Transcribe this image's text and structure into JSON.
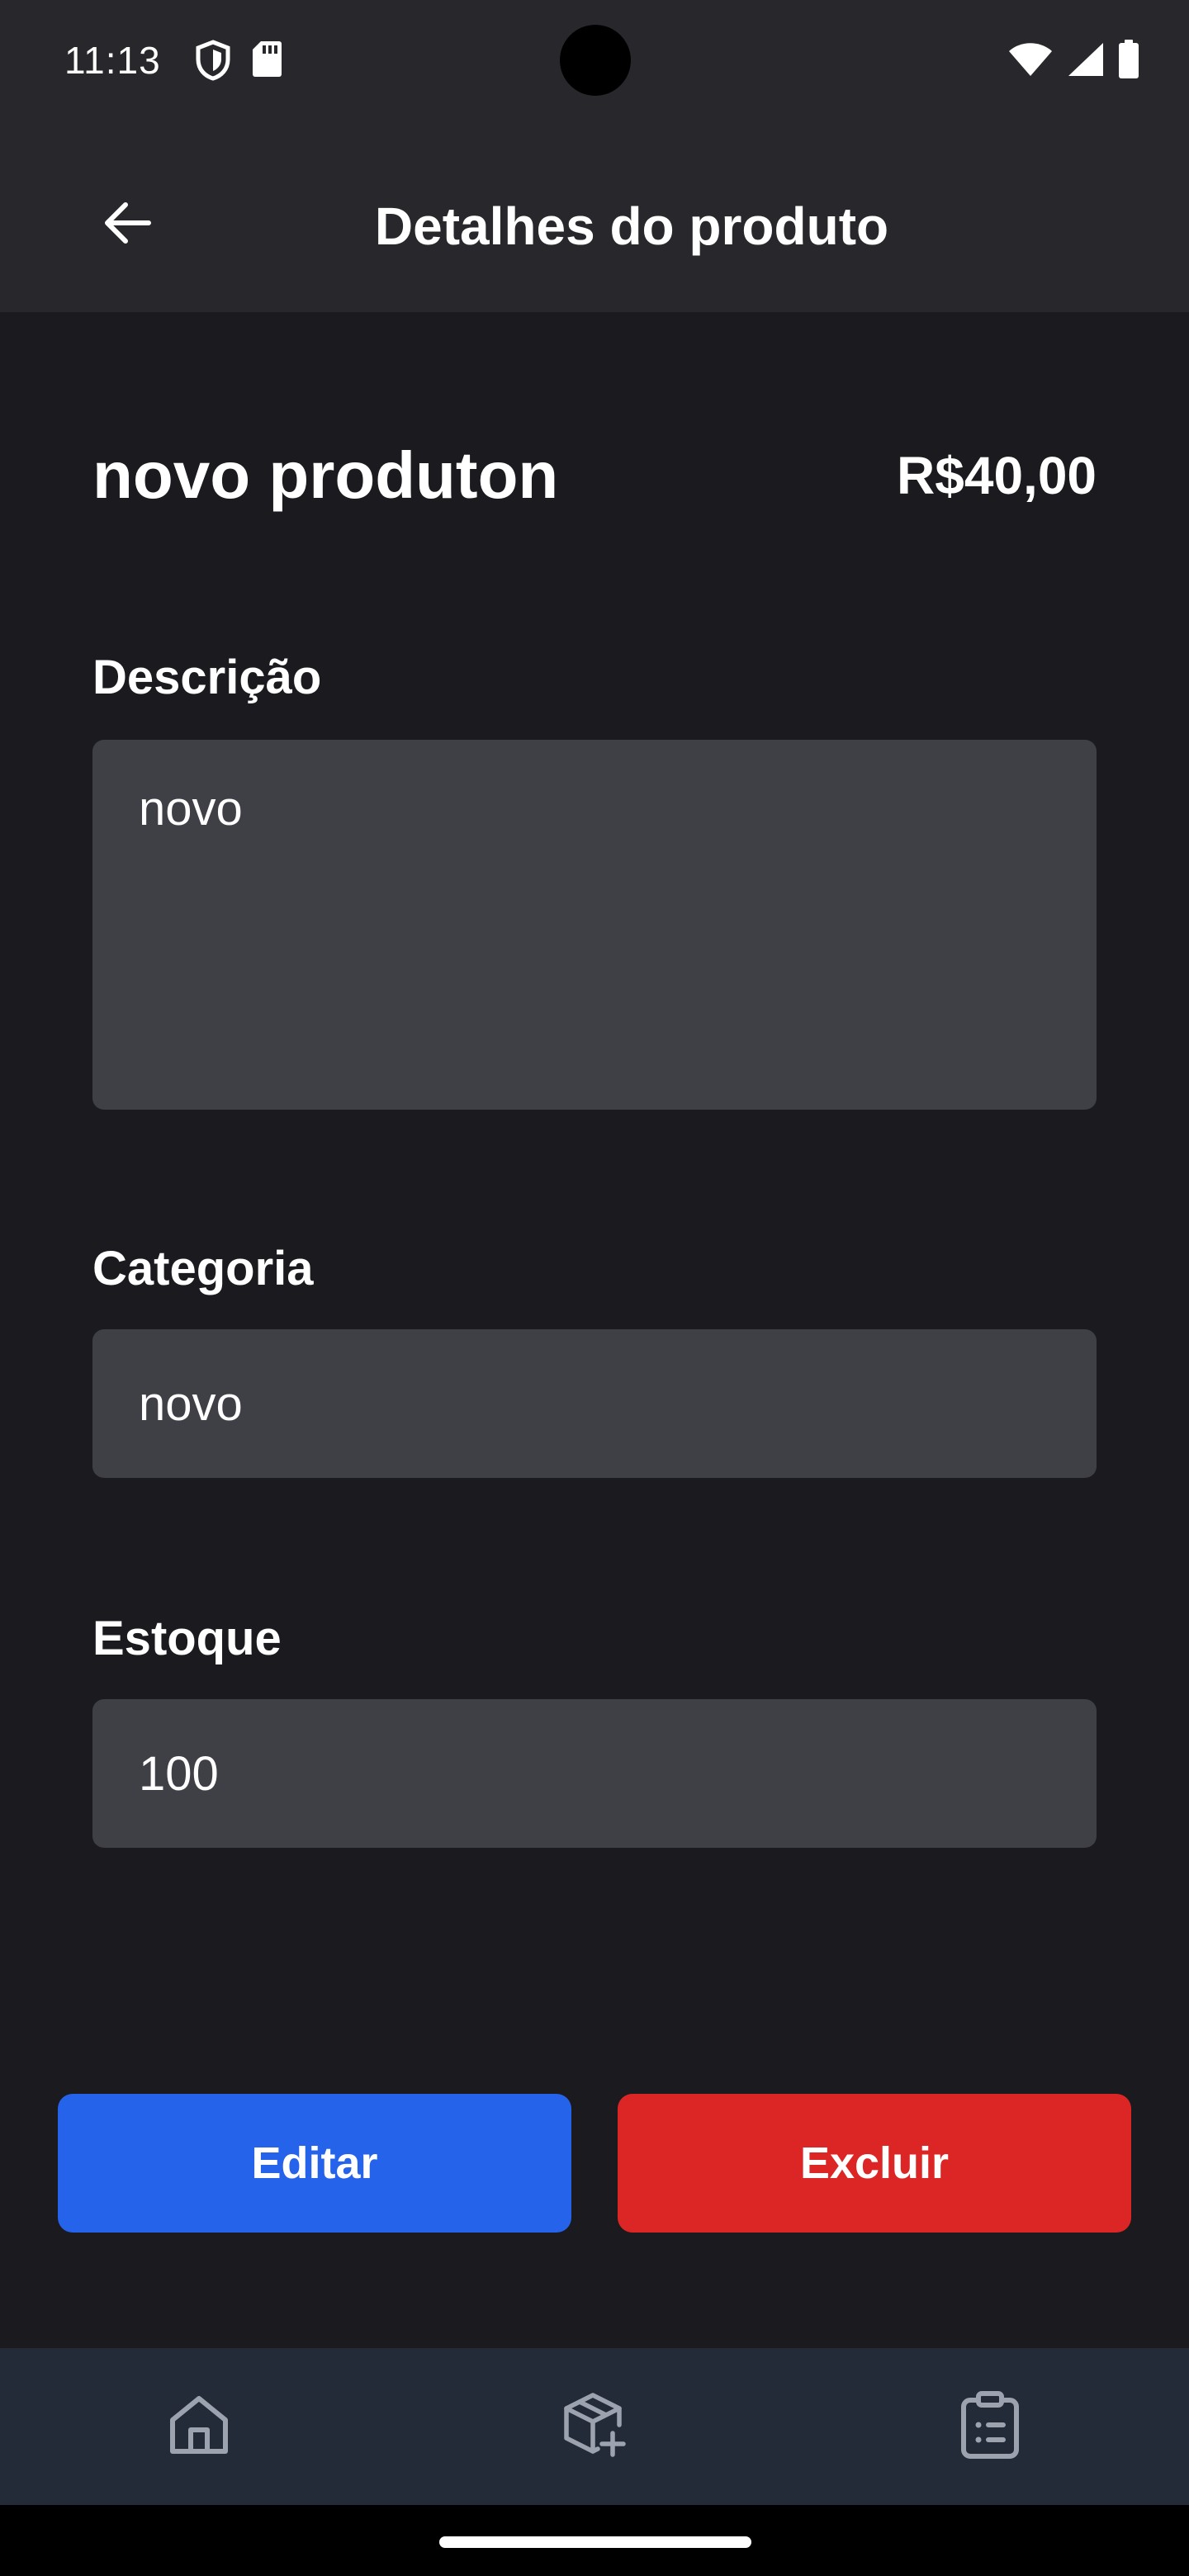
{
  "status_bar": {
    "time": "11:13",
    "left_icons": [
      "shield-icon",
      "sd-card-icon"
    ],
    "right_icons": [
      "wifi-icon",
      "signal-icon",
      "battery-icon"
    ]
  },
  "app_bar": {
    "back_icon": "arrow-left-icon",
    "title": "Detalhes do produto"
  },
  "product": {
    "name": "novo produton",
    "price": "R$40,00"
  },
  "fields": {
    "description": {
      "label": "Descrição",
      "value": "novo"
    },
    "category": {
      "label": "Categoria",
      "value": "novo"
    },
    "stock": {
      "label": "Estoque",
      "value": "100"
    }
  },
  "actions": {
    "edit_label": "Editar",
    "delete_label": "Excluir"
  },
  "bottom_nav": {
    "items": [
      {
        "icon": "home-icon"
      },
      {
        "icon": "package-add-icon"
      },
      {
        "icon": "clipboard-list-icon"
      }
    ]
  },
  "colors": {
    "background": "#1b1b1f",
    "app_bar": "#28282c",
    "field": "#3f3f46",
    "edit": "#2563eb",
    "delete": "#dc2626",
    "bottom_nav": "#232a38",
    "nav_icon": "#9ca3af"
  }
}
